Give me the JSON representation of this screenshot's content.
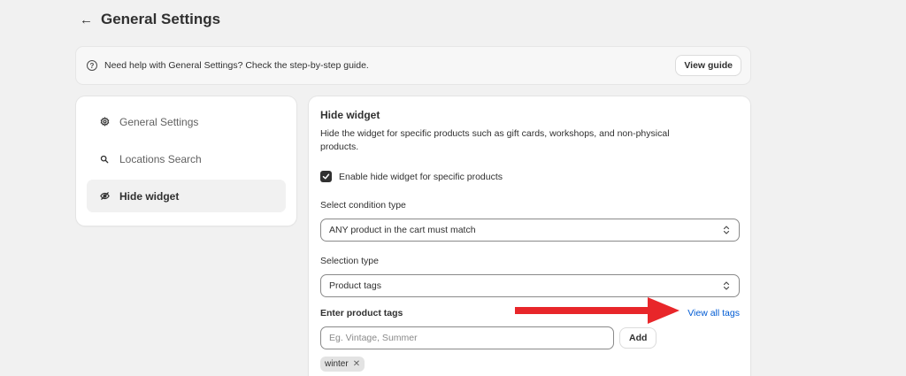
{
  "header": {
    "title": "General Settings",
    "back_icon": "arrow-left-icon"
  },
  "banner": {
    "text": "Need help with General Settings? Check the step-by-step guide.",
    "icon": "question-circle-icon",
    "button_label": "View guide"
  },
  "sidebar": {
    "items": [
      {
        "label": "General Settings",
        "icon": "gear-icon",
        "active": false
      },
      {
        "label": "Locations Search",
        "icon": "search-icon",
        "active": false
      },
      {
        "label": "Hide widget",
        "icon": "eye-slash-icon",
        "active": true
      }
    ]
  },
  "main": {
    "title": "Hide widget",
    "description": "Hide the widget for specific products such as gift cards, workshops, and non-physical products.",
    "checkbox": {
      "label": "Enable hide widget for specific products",
      "checked": true
    },
    "condition": {
      "label": "Select condition type",
      "value": "ANY product in the cart must match"
    },
    "selection": {
      "label": "Selection type",
      "value": "Product tags"
    },
    "tags": {
      "label": "Enter product tags",
      "view_all_label": "View all tags",
      "placeholder": "Eg. Vintage, Summer",
      "add_label": "Add",
      "chips": [
        "winter"
      ]
    }
  },
  "colors": {
    "background": "#f1f1f1",
    "card": "#ffffff",
    "text": "#303030",
    "link": "#005bd3",
    "annotation_arrow": "#e8262a"
  }
}
